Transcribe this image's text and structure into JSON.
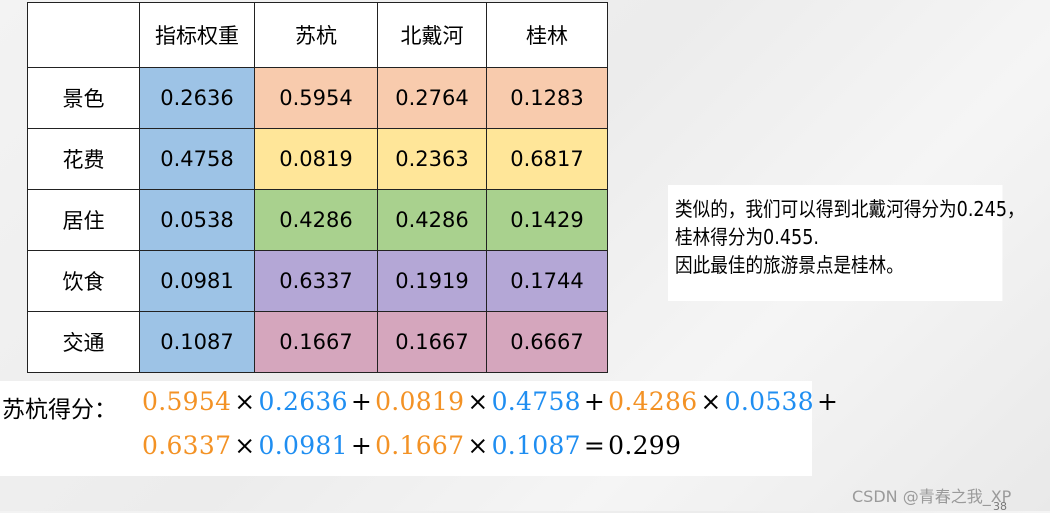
{
  "table": {
    "header": [
      "",
      "指标权重",
      "苏杭",
      "北戴河",
      "桂林"
    ],
    "rows": [
      {
        "label": "景色",
        "weight": "0.2636",
        "values": [
          "0.5954",
          "0.2764",
          "0.1283"
        ]
      },
      {
        "label": "花费",
        "weight": "0.4758",
        "values": [
          "0.0819",
          "0.2363",
          "0.6817"
        ]
      },
      {
        "label": "居住",
        "weight": "0.0538",
        "values": [
          "0.4286",
          "0.4286",
          "0.1429"
        ]
      },
      {
        "label": "饮食",
        "weight": "0.0981",
        "values": [
          "0.6337",
          "0.1919",
          "0.1744"
        ]
      },
      {
        "label": "交通",
        "weight": "0.1087",
        "values": [
          "0.1667",
          "0.1667",
          "0.6667"
        ]
      }
    ]
  },
  "colors": {
    "weight_column": "#9dc3e6",
    "row_colors": [
      "#f8cbad",
      "#ffe699",
      "#a9d18e",
      "#b4a7d6",
      "#d5a6bd"
    ],
    "formula_orange": "#f39225",
    "formula_blue": "#1f8ef1"
  },
  "note": {
    "lines": [
      "类似的，我们可以得到北戴河得分为0.245，",
      "桂林得分为0.455.",
      "因此最佳的旅游景点是桂林。"
    ]
  },
  "formula": {
    "label": "苏杭得分：",
    "terms": [
      {
        "a": "0.5954",
        "b": "0.2636"
      },
      {
        "a": "0.0819",
        "b": "0.4758"
      },
      {
        "a": "0.4286",
        "b": "0.0538"
      },
      {
        "a": "0.6337",
        "b": "0.0981"
      },
      {
        "a": "0.1667",
        "b": "0.1087"
      }
    ],
    "times": "×",
    "plus": "+",
    "equals": "=",
    "result": "0.299"
  },
  "watermark": "CSDN @青春之我_XP",
  "page_number": "38"
}
